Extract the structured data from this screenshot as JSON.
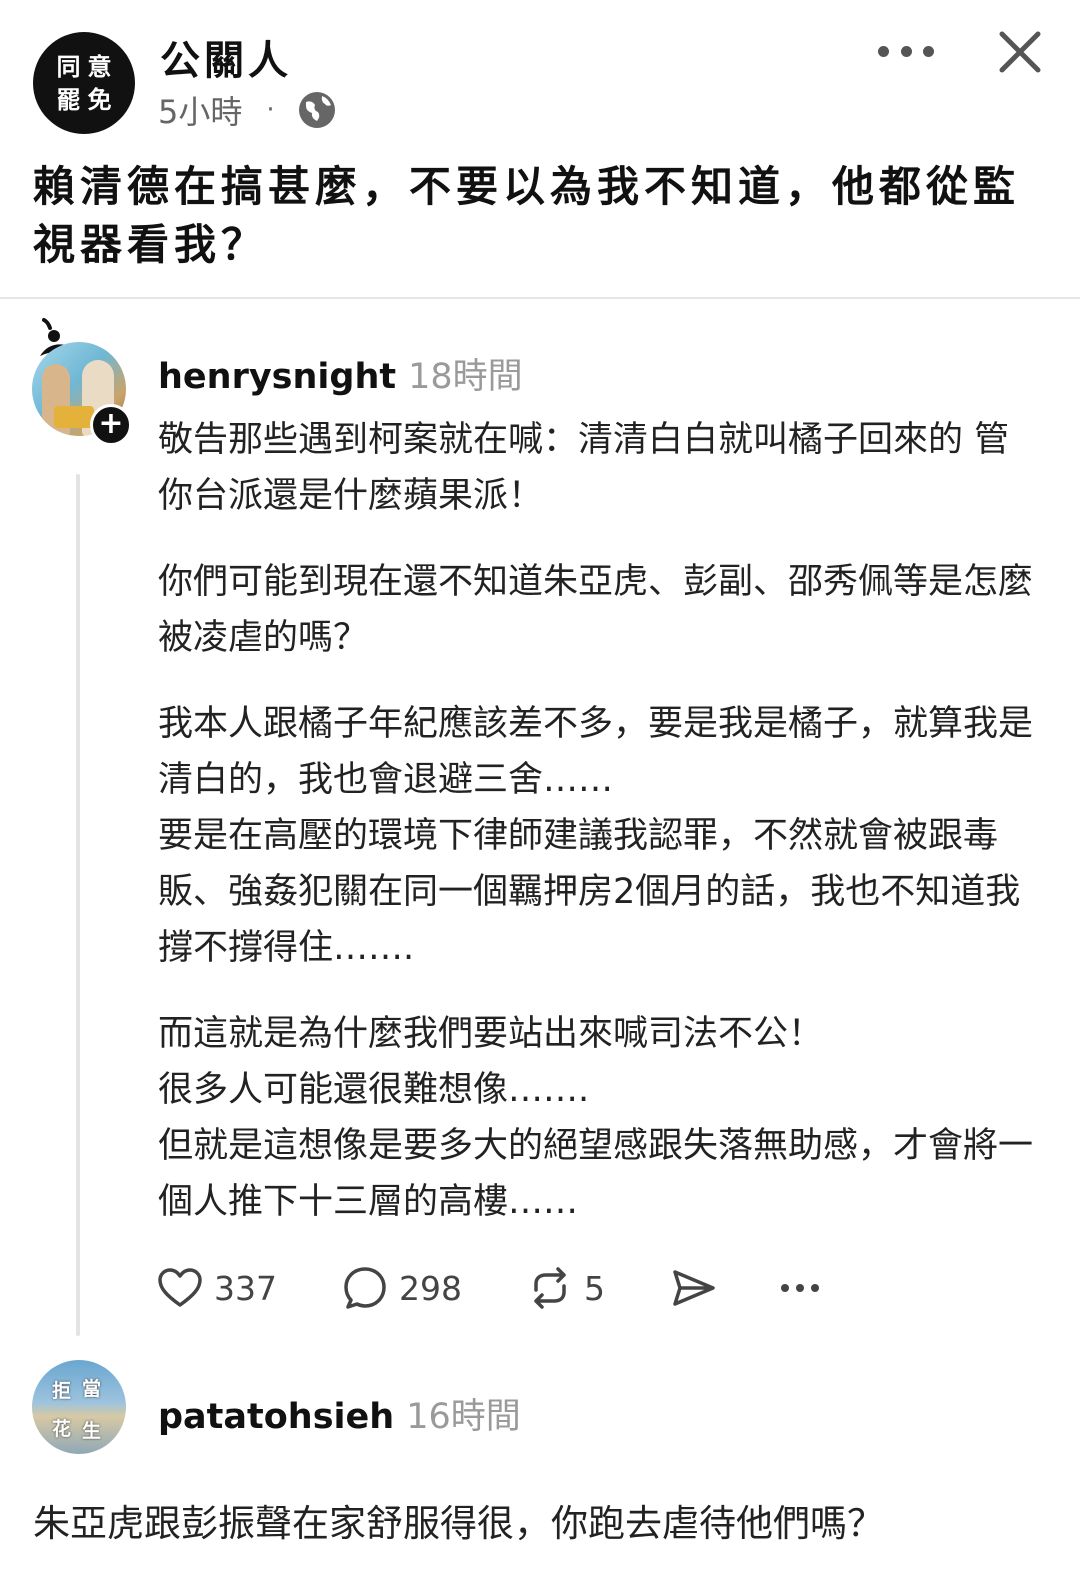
{
  "post": {
    "page_name": "公關人",
    "avatar_chars": [
      "同",
      "意",
      "罷",
      "免"
    ],
    "time": "5小時",
    "separator": "·",
    "visibility_icon": "globe-icon",
    "text": "賴清德在搞甚麼，不要以為我不知道，他都從監視器看我？"
  },
  "comment": {
    "username": "henrysnight",
    "time": "18時間",
    "follow_symbol": "+",
    "paragraphs": [
      "敬告那些遇到柯案就在喊：清清白白就叫橘子回來的 管你台派還是什麼蘋果派！",
      "你們可能到現在還不知道朱亞虎、彭副、邵秀佩等是怎麼被凌虐的嗎？",
      "我本人跟橘子年紀應該差不多，要是我是橘子，就算我是清白的，我也會退避三舍……\n要是在高壓的環境下律師建議我認罪，不然就會被跟毒販、強姦犯關在同一個羈押房2個月的話，我也不知道我撐不撐得住…….",
      "而這就是為什麼我們要站出來喊司法不公！\n很多人可能還很難想像…….\n但就是這想像是要多大的絕望感跟失落無助感，才會將一個人推下十三層的高樓……"
    ],
    "likes": "337",
    "replies": "298",
    "reposts": "5"
  },
  "reply": {
    "username": "patatohsieh",
    "time": "16時間",
    "avatar_chars": [
      "拒",
      "當",
      "花",
      "生"
    ],
    "text": "朱亞虎跟彭振聲在家舒服得很，你跑去虐待他們嗎？"
  },
  "colors": {
    "muted": "#9a9a9a",
    "text": "#222222",
    "divider": "#e6e6e6"
  }
}
